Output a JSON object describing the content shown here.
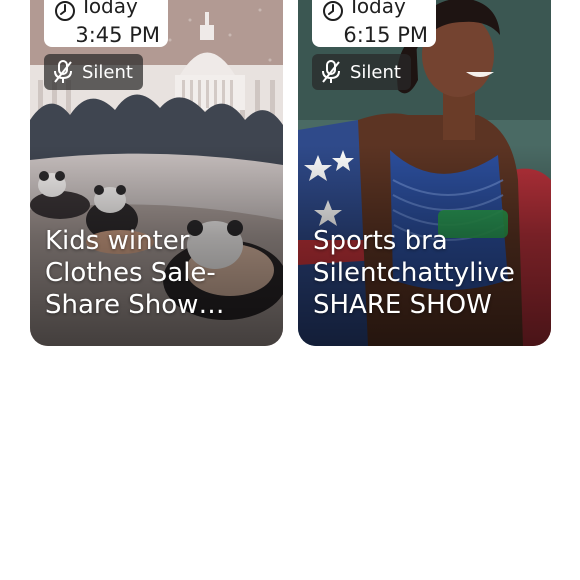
{
  "cards": [
    {
      "day": "Today",
      "time": "3:45 PM",
      "badge": "Silent",
      "title": "Kids winter Clothes Sale-Share Show (silent)"
    },
    {
      "day": "Today",
      "time": "6:15 PM",
      "badge": "Silent",
      "title": "Sports bra Silentchattylive SHARE SHOW"
    }
  ],
  "icons": {
    "clock": "clock-icon",
    "muted_mic": "mic-off-icon"
  },
  "colors": {
    "badge_bg": "#282828",
    "pill_bg": "#ffffff",
    "title_text": "#ffffff"
  }
}
